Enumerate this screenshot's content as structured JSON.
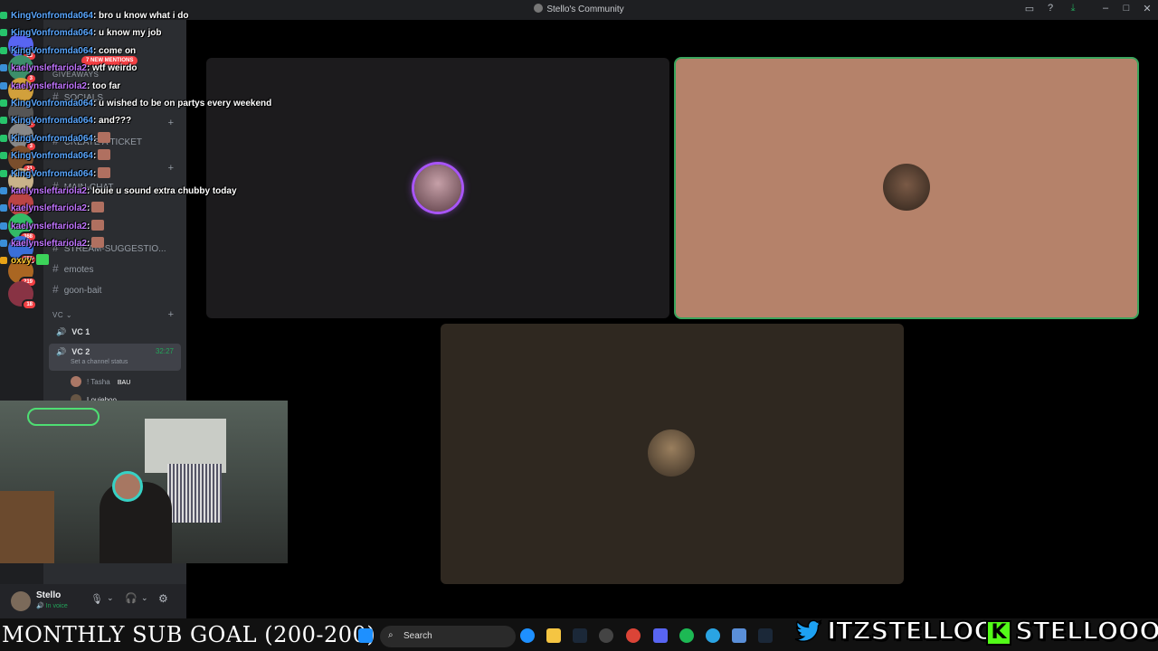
{
  "window": {
    "title": "Stello's Community",
    "controls": [
      "inbox-icon",
      "help-icon",
      "download-icon",
      "minimize-icon",
      "maximize-icon",
      "close-icon"
    ]
  },
  "servers": [
    {
      "badge": "23",
      "color": "#5865f2"
    },
    {
      "badge": "3",
      "color": "#3c8f6a"
    },
    {
      "badge": "",
      "color": "#d1a03c"
    },
    {
      "badge": "1",
      "color": "#555"
    },
    {
      "badge": "3",
      "color": "#888"
    },
    {
      "badge": "21",
      "color": "#7a4e2c"
    },
    {
      "badge": "",
      "color": "#c9b38a"
    },
    {
      "badge": "",
      "color": "#b44"
    },
    {
      "badge": "368",
      "color": "#3b6"
    },
    {
      "badge": "651",
      "color": "#3a6fd8"
    },
    {
      "badge": "219",
      "color": "#a62"
    },
    {
      "badge": "18",
      "color": "#834"
    }
  ],
  "mentions_pill": "7 NEW MENTIONS",
  "channels": {
    "items": [
      {
        "type": "category",
        "label": "GIVEAWAYS"
      },
      {
        "type": "channel",
        "label": "SOCIALS"
      },
      {
        "type": "channel",
        "label": "CREATE A TICKET"
      },
      {
        "type": "channel",
        "label": "MAIN-CHAT"
      },
      {
        "type": "channel",
        "label": "STREAM-SUGGESTIO..."
      },
      {
        "type": "channel",
        "label": "emotes"
      },
      {
        "type": "channel",
        "label": "goon-bait"
      }
    ],
    "vc_category": "VC",
    "vc1": "VC 1",
    "vc2": "VC 2",
    "vc2_timer": "32:27",
    "vc2_status": "Set a channel status",
    "vc_member1": "! Tasha",
    "vc_member1_tag": "BAU",
    "vc_member2": "Louieboo"
  },
  "chat": [
    {
      "name": "KingVonfromda064",
      "color": "k",
      "text": ": bro u know what i do"
    },
    {
      "name": "KingVonfromda064",
      "color": "k",
      "text": ": u know my job"
    },
    {
      "name": "KingVonfromda064",
      "color": "k",
      "text": ": come on"
    },
    {
      "name": "kaelynsleftariola2",
      "color": "p",
      "text": ": wtf weirdo"
    },
    {
      "name": "kaelynsleftariola2",
      "color": "p",
      "text": ": too far"
    },
    {
      "name": "KingVonfromda064",
      "color": "k",
      "text": ": u wished to be on partys every weekend"
    },
    {
      "name": "KingVonfromda064",
      "color": "k",
      "text": ": and???"
    },
    {
      "name": "KingVonfromda064",
      "color": "k",
      "text": ":",
      "emote": true
    },
    {
      "name": "KingVonfromda064",
      "color": "k",
      "text": ":",
      "emote": true
    },
    {
      "name": "KingVonfromda064",
      "color": "k",
      "text": ":",
      "emote": true
    },
    {
      "name": "kaelynsleftariola2",
      "color": "p",
      "text": ": louie u sound extra chubby today"
    },
    {
      "name": "kaelynsleftariola2",
      "color": "p",
      "text": ":",
      "emote": true
    },
    {
      "name": "kaelynsleftariola2",
      "color": "p",
      "text": ":",
      "emote": true
    },
    {
      "name": "kaelynsleftariola2",
      "color": "p",
      "text": ":",
      "emote": true
    },
    {
      "name": "oxvy",
      "color": "y",
      "text": ":",
      "emote": true
    }
  ],
  "user": {
    "name": "Stello",
    "status": "In voice"
  },
  "subgoal": "MONTHLY SUB GOAL (200-200)",
  "taskbar": {
    "search": "Search"
  },
  "socials": {
    "twitter": "ITZSTELLOO",
    "kick": "STELLOOO"
  },
  "colors": {
    "tile_dark": "#1c1b1d",
    "tile_peach": "#b5826a",
    "tile_brown": "#2f2820",
    "speaking": "#3ba55d",
    "twitter": "#1da1f2",
    "kick": "#53fc18"
  }
}
